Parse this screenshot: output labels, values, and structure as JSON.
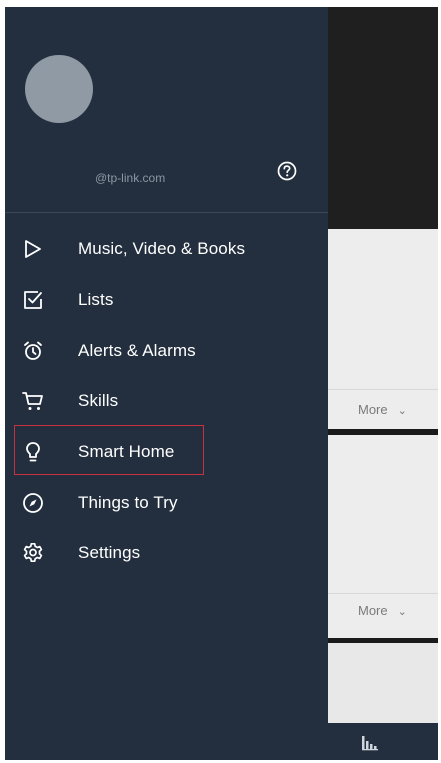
{
  "account": {
    "email": "@tp-link.com"
  },
  "menu": {
    "items": [
      {
        "label": "Music, Video & Books",
        "icon": "play-icon"
      },
      {
        "label": "Lists",
        "icon": "checklist-icon"
      },
      {
        "label": "Alerts & Alarms",
        "icon": "alarm-clock-icon"
      },
      {
        "label": "Skills",
        "icon": "cart-icon"
      },
      {
        "label": "Smart Home",
        "icon": "lightbulb-icon",
        "highlighted": true
      },
      {
        "label": "Things to Try",
        "icon": "compass-icon"
      },
      {
        "label": "Settings",
        "icon": "gear-icon"
      }
    ]
  },
  "background": {
    "more_label_1": "More",
    "more_label_2": "More"
  },
  "colors": {
    "drawer_bg": "#232f3e",
    "highlight_border": "#c7323f",
    "text": "#ffffff",
    "muted_text": "#8a96a3"
  }
}
